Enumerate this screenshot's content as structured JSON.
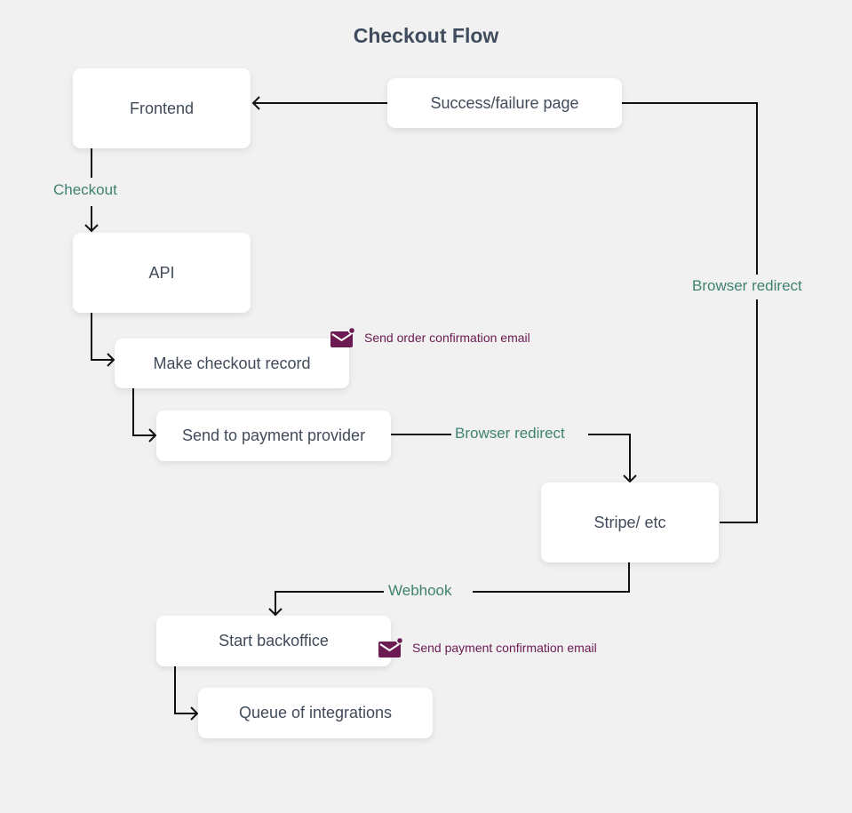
{
  "title": "Checkout Flow",
  "nodes": {
    "frontend": "Frontend",
    "api": "API",
    "checkout_record": "Make checkout record",
    "payment_provider": "Send to payment provider",
    "stripe": "Stripe/ etc",
    "success_page": "Success/failure page",
    "backoffice": "Start backoffice",
    "integrations": "Queue of integrations"
  },
  "edge_labels": {
    "checkout": "Checkout",
    "redirect_to_provider": "Browser redirect",
    "redirect_back": "Browser redirect",
    "webhook": "Webhook"
  },
  "notes": {
    "order_email": {
      "icon": "mail-notification-icon",
      "text": "Send order confirmation email"
    },
    "payment_email": {
      "icon": "mail-notification-icon",
      "text": "Send payment confirmation email"
    }
  },
  "colors": {
    "background": "#f1f1f1",
    "node_text": "#414b5a",
    "edge_label": "#3f8271",
    "note": "#6b1a52",
    "connector": "#111111"
  }
}
